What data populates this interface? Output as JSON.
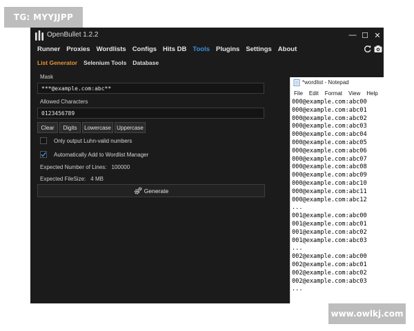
{
  "watermarks": {
    "top": "TG: MYYJJPP",
    "bottom": "www.owlkj.com"
  },
  "app": {
    "title": "OpenBullet 1.2.2"
  },
  "window_controls": {
    "minimize": "—",
    "maximize": "☐",
    "close": "✕"
  },
  "main_nav": [
    {
      "label": "Runner",
      "active": false
    },
    {
      "label": "Proxies",
      "active": false
    },
    {
      "label": "Wordlists",
      "active": false
    },
    {
      "label": "Configs",
      "active": false
    },
    {
      "label": "Hits DB",
      "active": false
    },
    {
      "label": "Tools",
      "active": true
    },
    {
      "label": "Plugins",
      "active": false
    },
    {
      "label": "Settings",
      "active": false
    },
    {
      "label": "About",
      "active": false
    }
  ],
  "nav_icons": [
    "refresh-icon",
    "camera-icon"
  ],
  "sub_nav": [
    {
      "label": "List Generator",
      "active": true
    },
    {
      "label": "Selenium Tools",
      "active": false
    },
    {
      "label": "Database",
      "active": false
    }
  ],
  "generator": {
    "mask_label": "Mask",
    "mask_value": "***@example.com:abc**",
    "allowed_label": "Allowed Characters",
    "allowed_value": "0123456789",
    "buttons": [
      "Clear",
      "Digits",
      "Lowercase",
      "Uppercase"
    ],
    "luhn": {
      "label": "Only output Luhn-valid numbers",
      "checked": false
    },
    "auto_add": {
      "label": "Automatically Add to Wordlist Manager",
      "checked": true
    },
    "expected_lines_label": "Expected Number of Lines:",
    "expected_lines_value": "100000",
    "expected_size_label": "Expected FileSize:",
    "expected_size_value": "4 MB",
    "generate_label": "Generate"
  },
  "notepad": {
    "title": "*wordlist - Notepad",
    "menu": [
      "File",
      "Edit",
      "Format",
      "View",
      "Help"
    ],
    "lines": [
      "000@example.com:abc00",
      "000@example.com:abc01",
      "000@example.com:abc02",
      "000@example.com:abc03",
      "000@example.com:abc04",
      "000@example.com:abc05",
      "000@example.com:abc06",
      "000@example.com:abc07",
      "000@example.com:abc08",
      "000@example.com:abc09",
      "000@example.com:abc10",
      "000@example.com:abc11",
      "000@example.com:abc12",
      "...",
      "001@example.com:abc00",
      "001@example.com:abc01",
      "001@example.com:abc02",
      "001@example.com:abc03",
      "...",
      "002@example.com:abc00",
      "002@example.com:abc01",
      "002@example.com:abc02",
      "002@example.com:abc03",
      "..."
    ]
  },
  "colors": {
    "window_bg": "#1b1b1b",
    "active_tab": "#3a8fd9",
    "active_subtab": "#e8953a",
    "check_accent": "#3a8fd9"
  }
}
